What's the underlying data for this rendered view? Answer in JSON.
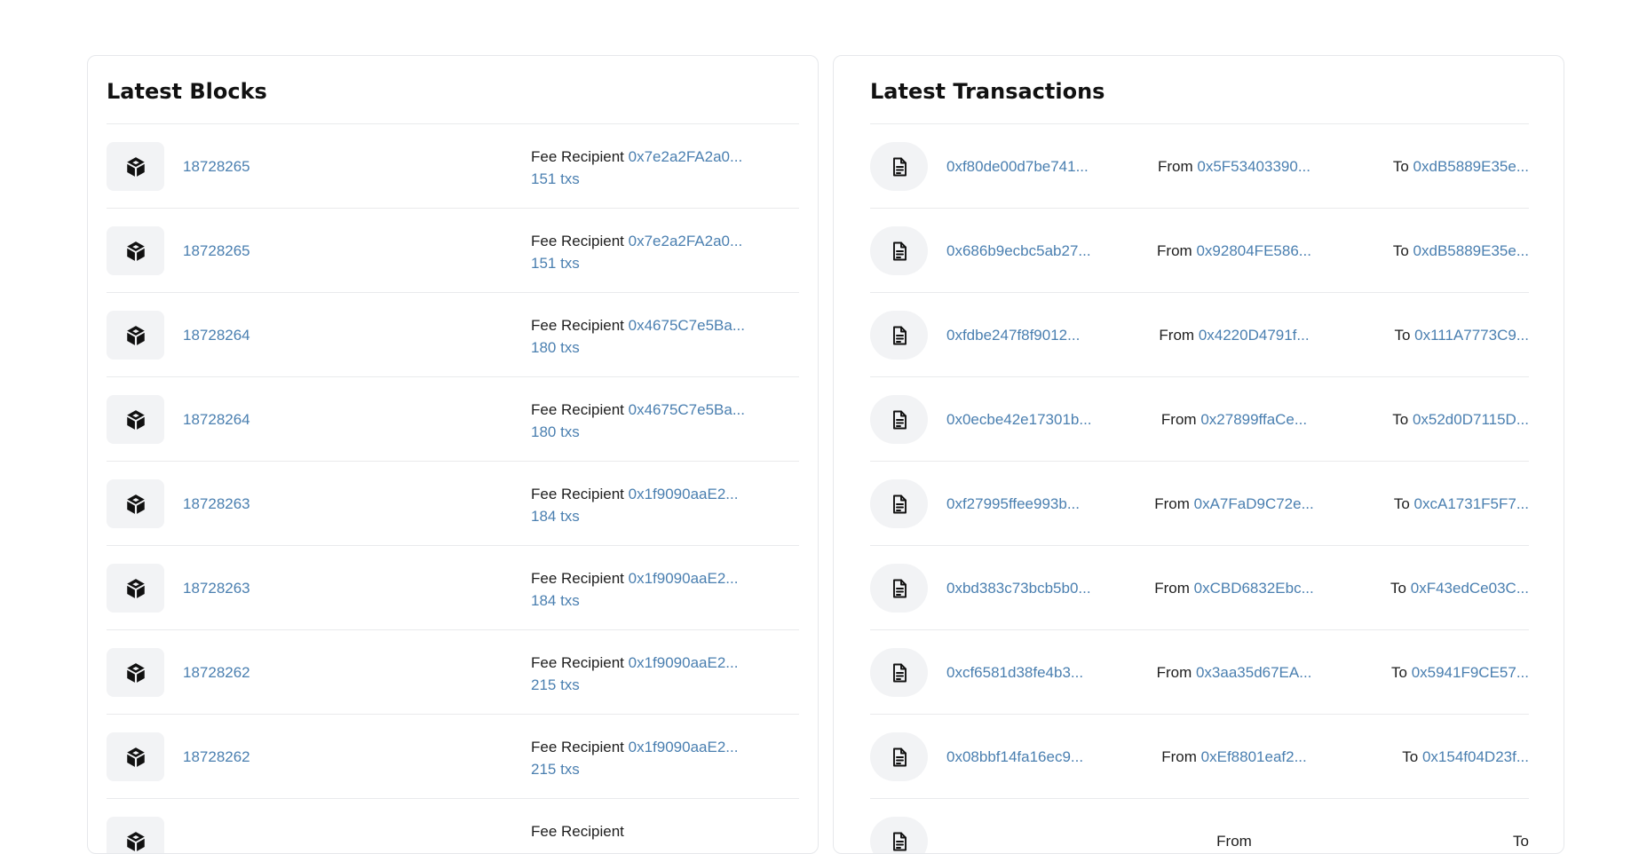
{
  "blocks": {
    "title": "Latest Blocks",
    "fee_label": "Fee Recipient",
    "icon": "cube-icon",
    "items": [
      {
        "number": "18728265",
        "recipient": "0x7e2a2FA2a0...",
        "txs": "151 txs"
      },
      {
        "number": "18728265",
        "recipient": "0x7e2a2FA2a0...",
        "txs": "151 txs"
      },
      {
        "number": "18728264",
        "recipient": "0x4675C7e5Ba...",
        "txs": "180 txs"
      },
      {
        "number": "18728264",
        "recipient": "0x4675C7e5Ba...",
        "txs": "180 txs"
      },
      {
        "number": "18728263",
        "recipient": "0x1f9090aaE2...",
        "txs": "184 txs"
      },
      {
        "number": "18728263",
        "recipient": "0x1f9090aaE2...",
        "txs": "184 txs"
      },
      {
        "number": "18728262",
        "recipient": "0x1f9090aaE2...",
        "txs": "215 txs"
      },
      {
        "number": "18728262",
        "recipient": "0x1f9090aaE2...",
        "txs": "215 txs"
      },
      {
        "number": "",
        "recipient": "",
        "txs": ""
      }
    ]
  },
  "transactions": {
    "title": "Latest Transactions",
    "from_label": "From",
    "to_label": "To",
    "icon": "document-icon",
    "items": [
      {
        "hash": "0xf80de00d7be741...",
        "from": "0x5F53403390...",
        "to": "0xdB5889E35e..."
      },
      {
        "hash": "0x686b9ecbc5ab27...",
        "from": "0x92804FE586...",
        "to": "0xdB5889E35e..."
      },
      {
        "hash": "0xfdbe247f8f9012...",
        "from": "0x4220D4791f...",
        "to": "0x111A7773C9..."
      },
      {
        "hash": "0x0ecbe42e17301b...",
        "from": "0x27899ffaCe...",
        "to": "0x52d0D7115D..."
      },
      {
        "hash": "0xf27995ffee993b...",
        "from": "0xA7FaD9C72e...",
        "to": "0xcA1731F5F7..."
      },
      {
        "hash": "0xbd383c73bcb5b0...",
        "from": "0xCBD6832Ebc...",
        "to": "0xF43edCe03C..."
      },
      {
        "hash": "0xcf6581d38fe4b3...",
        "from": "0x3aa35d67EA...",
        "to": "0x5941F9CE57..."
      },
      {
        "hash": "0x08bbf14fa16ec9...",
        "from": "0xEf8801eaf2...",
        "to": "0x154f04D23f..."
      },
      {
        "hash": "",
        "from": "",
        "to": ""
      }
    ]
  }
}
